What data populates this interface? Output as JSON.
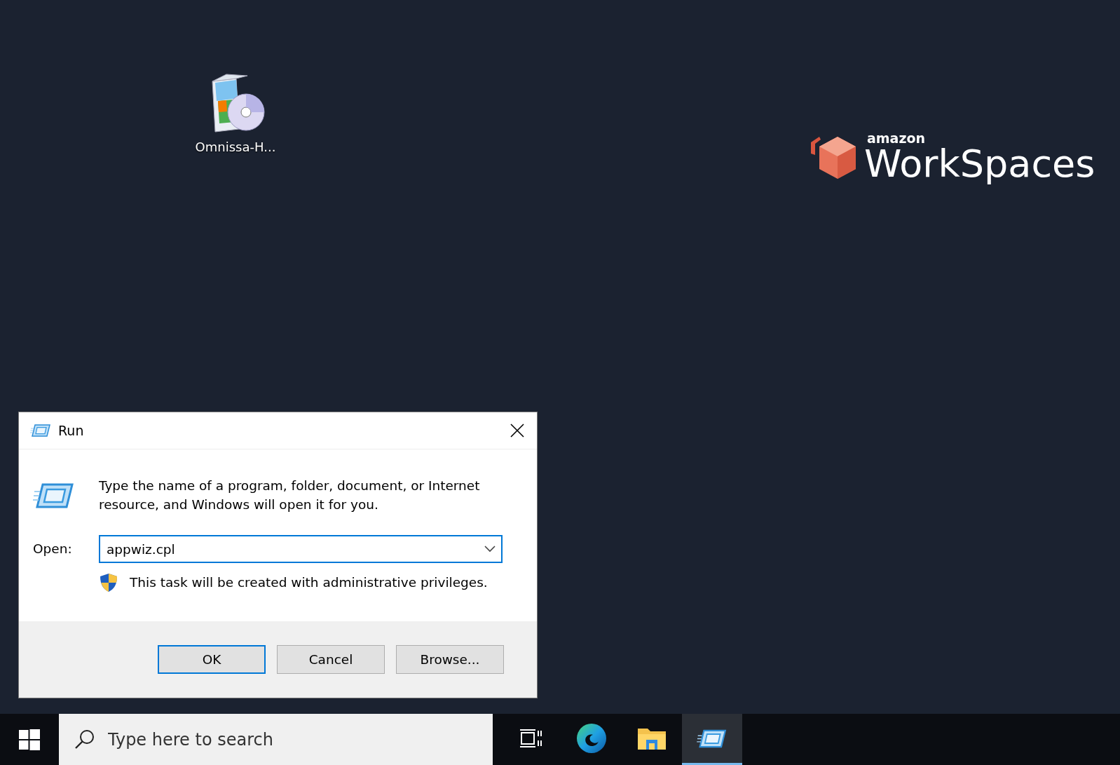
{
  "desktop": {
    "icons": [
      {
        "label": "Omnissa-H..."
      }
    ],
    "logo": {
      "brand": "amazon",
      "product": "WorkSpaces"
    }
  },
  "dialog": {
    "title": "Run",
    "description": "Type the name of a program, folder, document, or Internet resource, and Windows will open it for you.",
    "open_label": "Open:",
    "open_value": "appwiz.cpl",
    "admin_note": "This task will be created with administrative privileges.",
    "buttons": [
      {
        "label": "OK",
        "default": true
      },
      {
        "label": "Cancel",
        "default": false
      },
      {
        "label": "Browse...",
        "default": false
      }
    ]
  },
  "taskbar": {
    "search_placeholder": "Type here to search",
    "apps": [
      {
        "kind": "task-view",
        "selected": false
      },
      {
        "kind": "edge",
        "selected": false
      },
      {
        "kind": "explorer",
        "selected": false
      },
      {
        "kind": "run",
        "selected": true
      }
    ]
  }
}
